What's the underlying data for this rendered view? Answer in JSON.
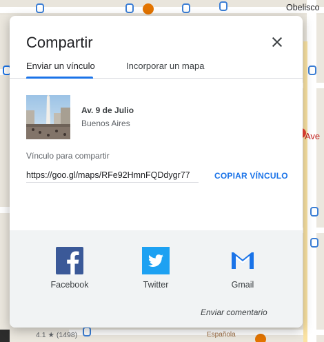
{
  "map": {
    "labels": {
      "obelisco": "Obelisco",
      "ave": "Ave",
      "rating": "4.1 ★ (1498)",
      "espanola": "Española"
    }
  },
  "dialog": {
    "title": "Compartir",
    "tabs": [
      {
        "label": "Enviar un vínculo",
        "active": true
      },
      {
        "label": "Incorporar un mapa",
        "active": false
      }
    ],
    "place": {
      "name": "Av. 9 de Julio",
      "subtitle": "Buenos Aires"
    },
    "link": {
      "label": "Vínculo para compartir",
      "value": "https://goo.gl/maps/RFe92HmnFQDdygr77",
      "copy_label": "COPIAR VÍNCULO"
    },
    "share": [
      {
        "label": "Facebook",
        "icon": "facebook-icon",
        "color": "#3b5998"
      },
      {
        "label": "Twitter",
        "icon": "twitter-icon",
        "color": "#1da1f2"
      },
      {
        "label": "Gmail",
        "icon": "gmail-icon",
        "color": "#1a73e8"
      }
    ],
    "feedback_label": "Enviar comentario"
  },
  "colors": {
    "accent": "#1a73e8",
    "share_background": "#f1f3f4"
  }
}
